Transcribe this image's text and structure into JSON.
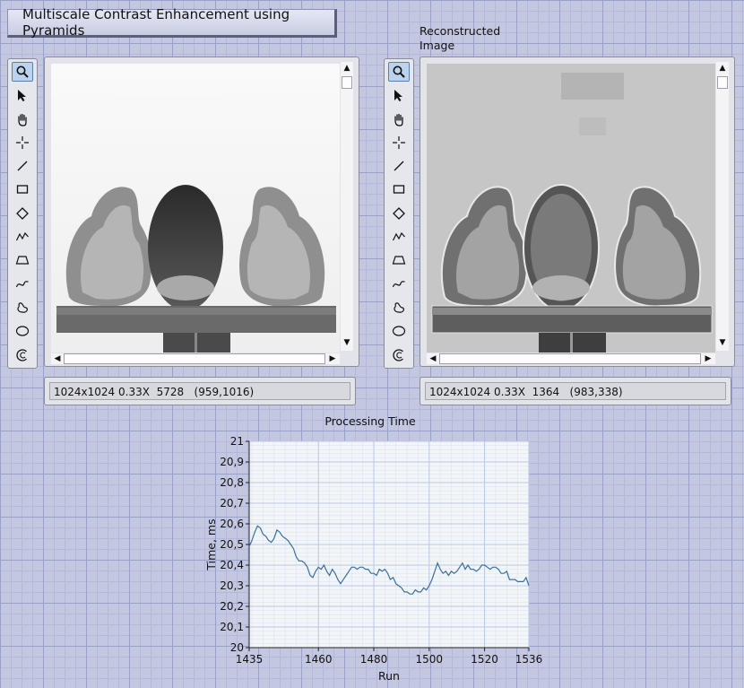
{
  "title": "Multiscale Contrast Enhancement using Pyramids",
  "tools": [
    {
      "name": "zoom-icon",
      "active": true
    },
    {
      "name": "pointer-icon",
      "active": false
    },
    {
      "name": "pan-hand-icon",
      "active": false
    },
    {
      "name": "crosshair-icon",
      "active": false
    },
    {
      "name": "line-icon",
      "active": false
    },
    {
      "name": "rectangle-icon",
      "active": false
    },
    {
      "name": "rotated-rectangle-icon",
      "active": false
    },
    {
      "name": "polyline-icon",
      "active": false
    },
    {
      "name": "polygon-icon",
      "active": false
    },
    {
      "name": "freehand-line-icon",
      "active": false
    },
    {
      "name": "freehand-region-icon",
      "active": false
    },
    {
      "name": "oval-icon",
      "active": false
    },
    {
      "name": "annulus-icon",
      "active": false
    }
  ],
  "left_display": {
    "status_text": "1024x1024 0.33X  5728   (959,1016)"
  },
  "right_display": {
    "label": "Reconstructed Image",
    "status_text": "1024x1024 0.33X  1364   (983,338)"
  },
  "scrollbar": {
    "up": "▲",
    "down": "▼",
    "left": "◀",
    "right": "▶"
  },
  "chart_data": {
    "type": "line",
    "title": "Processing Time",
    "xlabel": "Run",
    "ylabel": "Time, ms",
    "xlim": [
      1435,
      1536
    ],
    "ylim": [
      20,
      21
    ],
    "xticks": [
      1435,
      1460,
      1480,
      1500,
      1520,
      1536
    ],
    "yticks": [
      "20",
      "20,1",
      "20,2",
      "20,3",
      "20,4",
      "20,5",
      "20,6",
      "20,7",
      "20,8",
      "20,9",
      "21"
    ],
    "grid": true,
    "colors": {
      "line": "#3d6f9c",
      "plot_bg": "#f2f6f8",
      "grid": "#b9c6e6"
    },
    "series": [
      {
        "x": [
          1435,
          1436,
          1437,
          1438,
          1439,
          1440,
          1441,
          1442,
          1443,
          1444,
          1445,
          1446,
          1447,
          1448,
          1449,
          1450,
          1451,
          1452,
          1453,
          1454,
          1455,
          1456,
          1457,
          1458,
          1459,
          1460,
          1461,
          1462,
          1463,
          1464,
          1465,
          1466,
          1467,
          1468,
          1469,
          1470,
          1471,
          1472,
          1473,
          1474,
          1475,
          1476,
          1477,
          1478,
          1479,
          1480,
          1481,
          1482,
          1483,
          1484,
          1485,
          1486,
          1487,
          1488,
          1489,
          1490,
          1491,
          1492,
          1493,
          1494,
          1495,
          1496,
          1497,
          1498,
          1499,
          1500,
          1501,
          1502,
          1503,
          1504,
          1505,
          1506,
          1507,
          1508,
          1509,
          1510,
          1511,
          1512,
          1513,
          1514,
          1515,
          1516,
          1517,
          1518,
          1519,
          1520,
          1521,
          1522,
          1523,
          1524,
          1525,
          1526,
          1527,
          1528,
          1529,
          1530,
          1531,
          1532,
          1533,
          1534,
          1535,
          1536
        ],
        "values": [
          20.49,
          20.52,
          20.56,
          20.59,
          20.58,
          20.55,
          20.54,
          20.52,
          20.51,
          20.53,
          20.57,
          20.56,
          20.54,
          20.53,
          20.52,
          20.5,
          20.48,
          20.44,
          20.42,
          20.42,
          20.41,
          20.39,
          20.35,
          20.34,
          20.37,
          20.39,
          20.38,
          20.4,
          20.37,
          20.35,
          20.38,
          20.36,
          20.33,
          20.31,
          20.33,
          20.35,
          20.37,
          20.39,
          20.39,
          20.38,
          20.39,
          20.39,
          20.38,
          20.38,
          20.36,
          20.36,
          20.35,
          20.38,
          20.37,
          20.38,
          20.36,
          20.33,
          20.34,
          20.31,
          20.3,
          20.29,
          20.27,
          20.27,
          20.26,
          20.26,
          20.28,
          20.27,
          20.27,
          20.29,
          20.28,
          20.3,
          20.33,
          20.37,
          20.41,
          20.38,
          20.36,
          20.37,
          20.35,
          20.37,
          20.36,
          20.37,
          20.39,
          20.41,
          20.38,
          20.4,
          20.38,
          20.38,
          20.37,
          20.38,
          20.4,
          20.4,
          20.39,
          20.38,
          20.39,
          20.39,
          20.38,
          20.36,
          20.36,
          20.37,
          20.33,
          20.33,
          20.33,
          20.32,
          20.32,
          20.32,
          20.34,
          20.3
        ]
      }
    ]
  }
}
